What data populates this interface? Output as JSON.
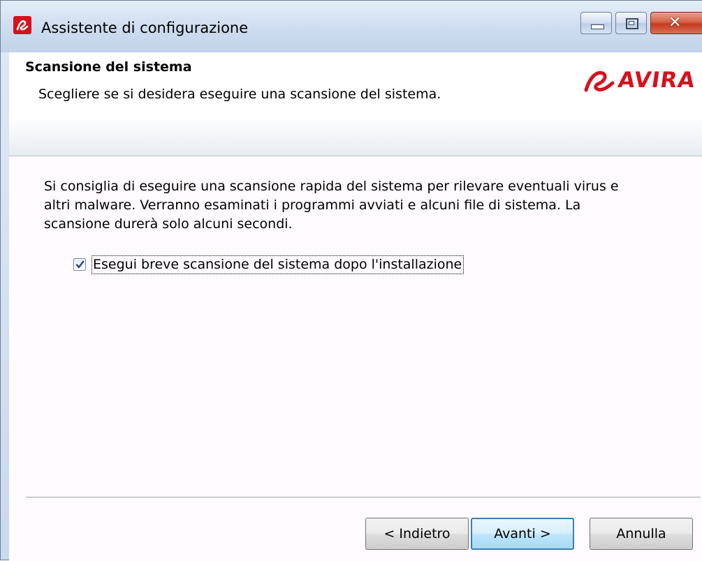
{
  "window": {
    "title": "Assistente di configurazione",
    "brand_color": "#d5121e",
    "controls": {
      "minimize_icon": "minimize-icon",
      "maximize_icon": "maximize-icon",
      "close_label": "✕"
    }
  },
  "header": {
    "title": "Scansione del sistema",
    "subtitle": "Scegliere se si desidera eseguire una scansione del sistema.",
    "logo_text": "AVIRA"
  },
  "main": {
    "description": "Si consiglia di eseguire una scansione rapida del sistema per rilevare eventuali virus e altri malware. Verranno esaminati i programmi avviati e alcuni file di sistema. La scansione durerà solo alcuni secondi.",
    "checkbox": {
      "label": "Esegui breve scansione del sistema dopo l'installazione",
      "checked": true
    }
  },
  "footer": {
    "back_label": "< Indietro",
    "next_label": "Avanti >",
    "cancel_label": "Annulla"
  }
}
